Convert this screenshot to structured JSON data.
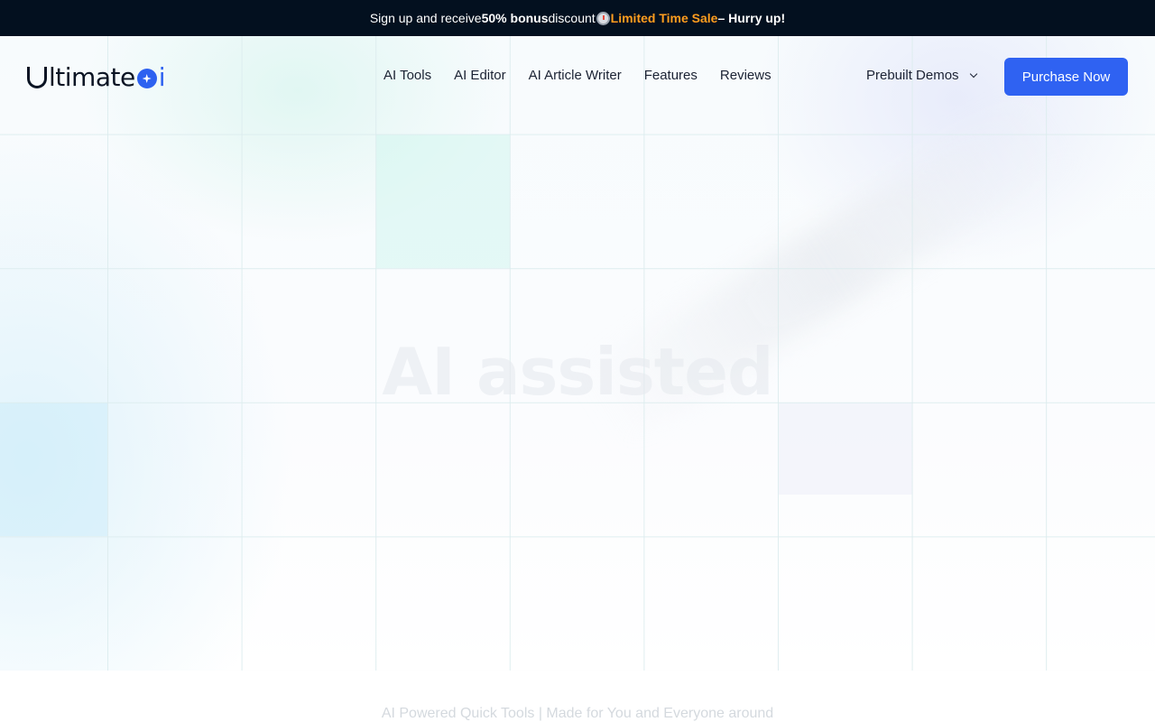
{
  "promo": {
    "text_before": "Sign up and receive ",
    "bonus": "50% bonus",
    "text_after": " discount",
    "clock_icon": "stopwatch-icon",
    "sale": "Limited Time Sale",
    "hurry": " – Hurry up!"
  },
  "header": {
    "logo_text": "ltimate",
    "logo_suffix": "i",
    "nav": [
      {
        "label": "AI Tools"
      },
      {
        "label": "AI Editor"
      },
      {
        "label": "AI Article Writer"
      },
      {
        "label": "Features"
      },
      {
        "label": "Reviews"
      }
    ],
    "demos_label": "Prebuilt Demos",
    "purchase_label": "Purchase Now"
  },
  "hero": {
    "title": "AI assisted",
    "subtitle": "AI Powered Quick Tools | Made for You and Everyone around"
  },
  "colors": {
    "accent": "#2f62f2",
    "promo_bg": "#03101f",
    "sale": "#ff9d1f"
  }
}
